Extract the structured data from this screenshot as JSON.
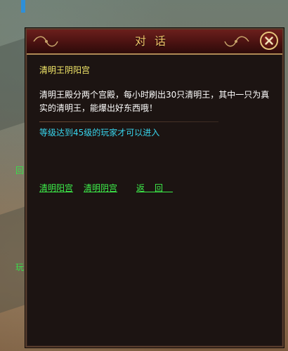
{
  "background": {
    "left_text_1": "回",
    "left_text_2": "玩"
  },
  "dialog": {
    "title": "对话",
    "close_icon": "close-x-icon",
    "npc_name": "清明王阴阳宫",
    "description": "清明王殿分两个宫殿，每小时刷出30只清明王，其中一只为真实的清明王，能爆出好东西哦！",
    "requirement": "等级达到45级的玩家才可以进入",
    "options": [
      {
        "label": "清明阳宫"
      },
      {
        "label": "清明阴宫"
      },
      {
        "label": "返回"
      }
    ]
  },
  "colors": {
    "title": "#f0c46a",
    "npc_name": "#f5ea6a",
    "requirement": "#38d6ee",
    "option_link": "#3df04a",
    "panel_bg": "#1c1412"
  }
}
